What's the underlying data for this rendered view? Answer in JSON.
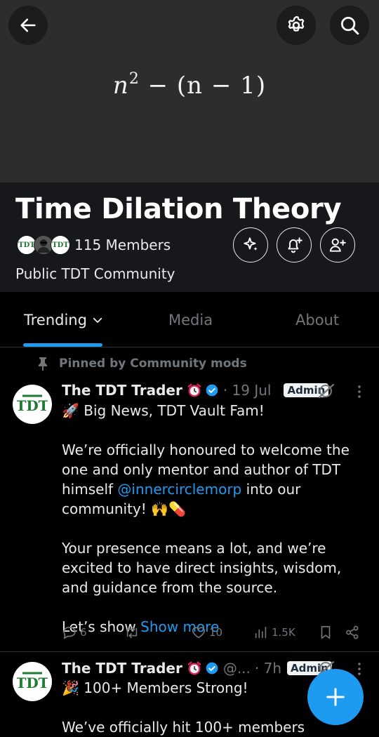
{
  "banner": {
    "formula_n": "n",
    "formula_exp": "2",
    "formula_rest": " − (n − 1)"
  },
  "community": {
    "title": "Time Dilation Theory",
    "members": "115 Members",
    "type": "Public TDT Community"
  },
  "avatars": [
    "TDT",
    "TDT"
  ],
  "tabs": [
    {
      "label": "Trending"
    },
    {
      "label": "Media"
    },
    {
      "label": "About"
    }
  ],
  "pinned_label": "Pinned by Community mods",
  "posts": [
    {
      "author": "The TDT Trader",
      "handle": "",
      "time": "· 19 Jul",
      "badge": "Admin",
      "avatar_text": "TDT",
      "headline": "Big News, TDT Vault Fam!",
      "p1_before": "We’re officially honoured to welcome the one and only mentor and author of TDT himself ",
      "mention": "@innercirclemorp",
      "p1_after": " into our community! 🙌💊",
      "p2": "Your presence means a lot, and we’re excited to have direct insights, wisdom, and guidance from the source.",
      "p3": "Let’s show ",
      "show_more": "Show more",
      "replies": "6",
      "likes": "10",
      "views": "1.5K"
    },
    {
      "author": "The TDT Trader",
      "handle": "@...",
      "time": "· 7h",
      "badge": "Admin",
      "avatar_text": "TDT",
      "headline": "100+ Members Strong!",
      "p1": "We’ve officially hit 100+ members"
    }
  ],
  "colors": {
    "accent": "#1d9bf0",
    "banner": "#2d2d2d",
    "header": "#16181c",
    "muted": "#71767b",
    "logo_green": "#1f7a33"
  },
  "icons": [
    "back-arrow-icon",
    "settings-gear-icon",
    "search-icon",
    "sparkle-icon",
    "bell-plus-icon",
    "add-person-icon",
    "pin-icon",
    "alarm-clock-icon",
    "verified-badge-icon",
    "grok-slash-icon",
    "more-vertical-icon",
    "reply-icon",
    "repost-icon",
    "like-icon",
    "views-icon",
    "bookmark-icon",
    "share-icon",
    "plus-icon"
  ]
}
